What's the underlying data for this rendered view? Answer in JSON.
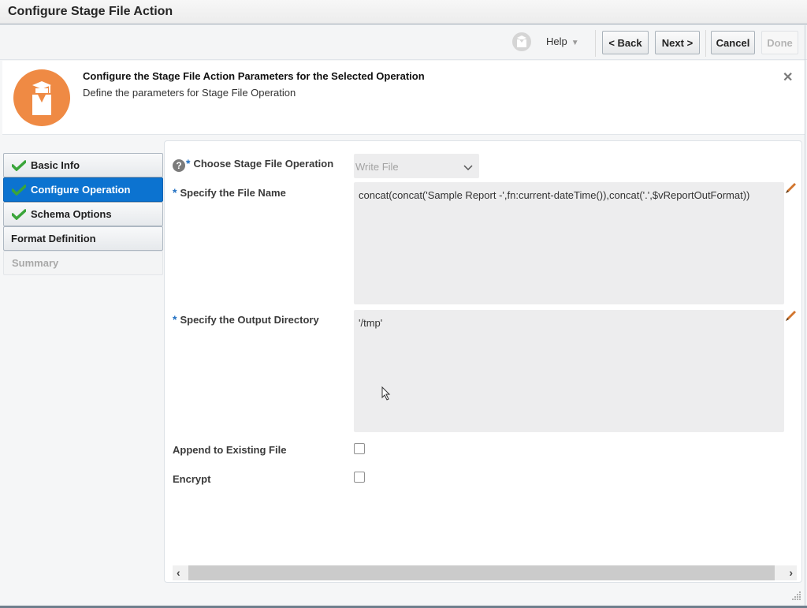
{
  "window": {
    "title": "Configure Stage File Action"
  },
  "toolbar": {
    "help_label": "Help",
    "help_caret": "▼",
    "back_label": "< Back",
    "next_label": "Next >",
    "cancel_label": "Cancel",
    "done_label": "Done"
  },
  "header": {
    "title": "Configure the Stage File Action Parameters for the Selected Operation",
    "subtitle": "Define the parameters for Stage File Operation",
    "close_glyph": "✕"
  },
  "train": {
    "items": [
      {
        "label": "Basic Info",
        "state": "completed"
      },
      {
        "label": "Configure Operation",
        "state": "active"
      },
      {
        "label": "Schema Options",
        "state": "completed"
      },
      {
        "label": "Format Definition",
        "state": "pending"
      },
      {
        "label": "Summary",
        "state": "disabled"
      }
    ]
  },
  "form": {
    "required_marker": "*",
    "help_glyph": "?",
    "operation": {
      "label": "Choose Stage File Operation",
      "value": "Write File"
    },
    "file_name": {
      "label": "Specify the File Name",
      "value": "concat(concat('Sample Report -',fn:current-dateTime()),concat('.',$vReportOutFormat))"
    },
    "output_directory": {
      "label": "Specify the Output Directory",
      "value": "'/tmp'"
    },
    "append": {
      "label": "Append to Existing File",
      "checked": false
    },
    "encrypt": {
      "label": "Encrypt",
      "checked": false
    }
  },
  "scrollbar": {
    "left_glyph": "‹",
    "right_glyph": "›"
  },
  "colors": {
    "accent": "#0c73d0",
    "logo": "#ef8a44",
    "check": "#3aa53a",
    "required": "#1f6fc2"
  }
}
